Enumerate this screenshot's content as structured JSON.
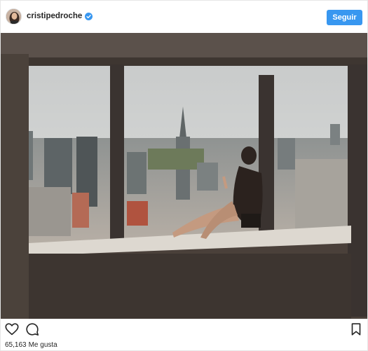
{
  "header": {
    "username": "cristipedroche",
    "follow_label": "Seguir",
    "verified": true
  },
  "post": {
    "likes_count": "65,163",
    "likes_label": "Me gusta"
  },
  "icons": {
    "like": "heart-icon",
    "comment": "comment-icon",
    "save": "bookmark-icon",
    "verified": "verified-badge-icon"
  },
  "colors": {
    "accent": "#3897f0",
    "text": "#262626"
  }
}
